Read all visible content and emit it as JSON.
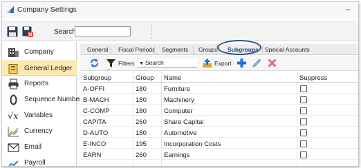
{
  "window": {
    "title": "Company Settings"
  },
  "toolbar": {
    "search_label": "Search",
    "search_value": ""
  },
  "sidebar": {
    "items": [
      {
        "label": "Company",
        "icon": "building-icon"
      },
      {
        "label": "General Ledger",
        "icon": "ledger-icon"
      },
      {
        "label": "Reports",
        "icon": "printer-icon"
      },
      {
        "label": "Sequence Number",
        "icon": "sequence-icon"
      },
      {
        "label": "Variables",
        "icon": "function-icon"
      },
      {
        "label": "Currency",
        "icon": "currency-chart-icon"
      },
      {
        "label": "Email",
        "icon": "envelope-icon"
      },
      {
        "label": "Payroll",
        "icon": "payroll-icon"
      }
    ],
    "active_index": 1
  },
  "tabs": [
    {
      "label": "General"
    },
    {
      "label": "Fiscal Periods"
    },
    {
      "label": "Segments"
    },
    {
      "label": "Groups"
    },
    {
      "label": "Subgroups"
    },
    {
      "label": "Special Accounts"
    }
  ],
  "active_tab": "Subgroups",
  "subbar": {
    "filters_label": "Filters",
    "search_placeholder": "Search",
    "export_label": "Export"
  },
  "grid": {
    "columns": [
      "Subgroup",
      "Group",
      "Name",
      "Suppress"
    ],
    "rows": [
      {
        "subgroup": "A-OFFI",
        "group": "180",
        "name": "Furniture",
        "suppress": false
      },
      {
        "subgroup": "B-MACH",
        "group": "180",
        "name": "Machinery",
        "suppress": false
      },
      {
        "subgroup": "C-COMP",
        "group": "180",
        "name": "Computer",
        "suppress": false
      },
      {
        "subgroup": "CAPITA",
        "group": "260",
        "name": "Share Capital",
        "suppress": false
      },
      {
        "subgroup": "D-AUTO",
        "group": "180",
        "name": "Automotive",
        "suppress": false
      },
      {
        "subgroup": "E-INCO",
        "group": "195",
        "name": "Incorporation Costs",
        "suppress": false
      },
      {
        "subgroup": "EARN",
        "group": "260",
        "name": "Earnings",
        "suppress": false
      }
    ]
  },
  "colors": {
    "active_item_bg": "#fde9b0",
    "highlight_ring": "#2b4e86",
    "accent_blue": "#1e6fd9",
    "delete_red": "#e06a7a"
  }
}
